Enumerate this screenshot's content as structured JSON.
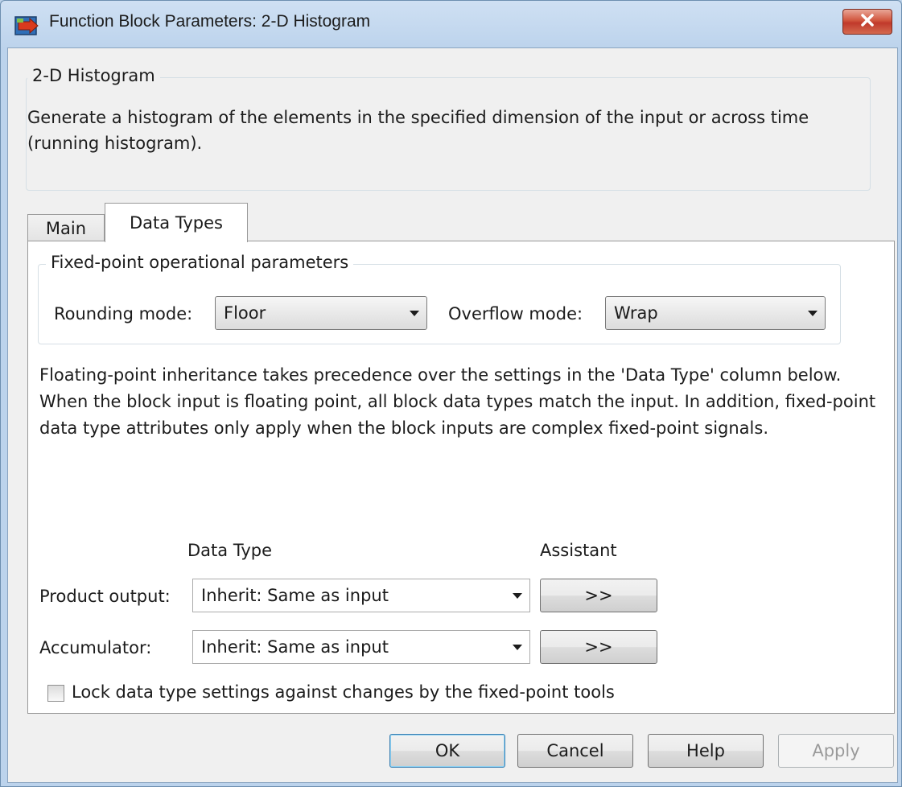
{
  "window": {
    "title": "Function Block Parameters: 2-D Histogram",
    "close_icon": "close-icon"
  },
  "block": {
    "group_label": "2-D Histogram",
    "description": "Generate a histogram of the elements in the specified dimension of the input or across time (running histogram)."
  },
  "tabs": [
    {
      "label": "Main",
      "active": false
    },
    {
      "label": "Data Types",
      "active": true
    }
  ],
  "fixed_point": {
    "group_label": "Fixed-point operational parameters",
    "rounding_label": "Rounding mode:",
    "rounding_value": "Floor",
    "overflow_label": "Overflow mode:",
    "overflow_value": "Wrap"
  },
  "info_text": "Floating-point inheritance takes precedence over the settings in the 'Data Type' column below. When the block input is floating point, all block data types match the input. In addition, fixed-point data type attributes only apply when the block inputs are complex fixed-point signals.",
  "table": {
    "col_data_type": "Data Type",
    "col_assistant": "Assistant",
    "rows": [
      {
        "label": "Product output:",
        "value": "Inherit: Same as input",
        "assistant": ">>"
      },
      {
        "label": "Accumulator:",
        "value": "Inherit: Same as input",
        "assistant": ">>"
      }
    ]
  },
  "lock_checkbox": {
    "label": "Lock data type settings against changes by the fixed-point tools",
    "checked": false
  },
  "buttons": {
    "ok": "OK",
    "cancel": "Cancel",
    "help": "Help",
    "apply": "Apply"
  },
  "colors": {
    "frame": "#bcd3ec",
    "default_button_border": "#3c7fb1",
    "close_button": "#c0392b"
  }
}
